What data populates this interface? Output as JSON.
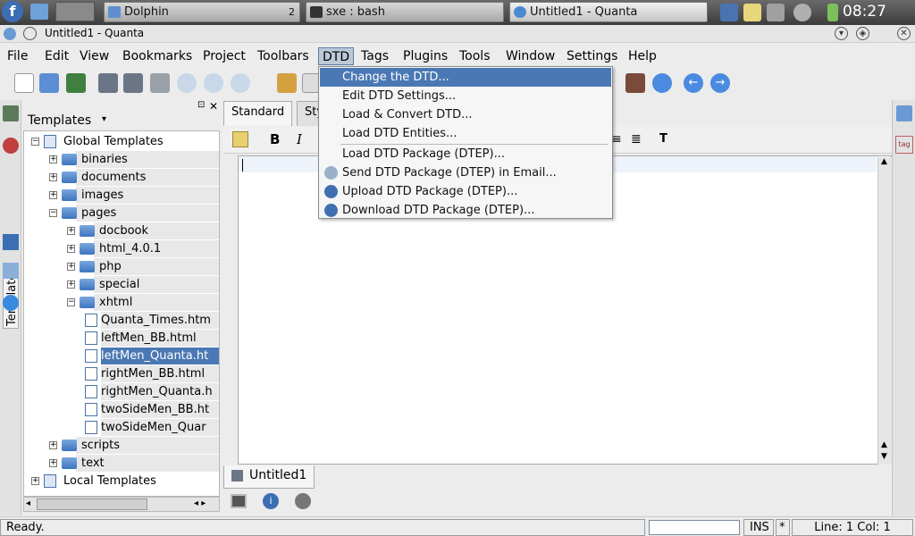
{
  "taskbar": {
    "tasks": [
      {
        "label": "Dolphin",
        "badge": "2"
      },
      {
        "label": "sxe : bash"
      },
      {
        "label": "Untitled1 - Quanta"
      }
    ],
    "clock": "08:27"
  },
  "window": {
    "title": "Untitled1 - Quanta"
  },
  "menubar": [
    "File",
    "Edit",
    "View",
    "Bookmarks",
    "Project",
    "Toolbars",
    "DTD",
    "Tags",
    "Plugins",
    "Tools",
    "Window",
    "Settings",
    "Help"
  ],
  "side_tab": {
    "label": "Templates"
  },
  "templates_panel": {
    "title": "Templates",
    "tree": [
      {
        "label": "Global Templates",
        "type": "root",
        "state": "-"
      },
      {
        "label": "binaries",
        "type": "folder",
        "state": "+"
      },
      {
        "label": "documents",
        "type": "folder",
        "state": "+"
      },
      {
        "label": "images",
        "type": "folder",
        "state": "+"
      },
      {
        "label": "pages",
        "type": "folder",
        "state": "-"
      },
      {
        "label": "docbook",
        "type": "folder",
        "state": "+"
      },
      {
        "label": "html_4.0.1",
        "type": "folder",
        "state": "+"
      },
      {
        "label": "php",
        "type": "folder",
        "state": "+"
      },
      {
        "label": "special",
        "type": "folder",
        "state": "+"
      },
      {
        "label": "xhtml",
        "type": "folder",
        "state": "-"
      },
      {
        "label": "Quanta_Times.htm",
        "type": "file"
      },
      {
        "label": "leftMen_BB.html",
        "type": "file"
      },
      {
        "label": "leftMen_Quanta.ht",
        "type": "file",
        "selected": true
      },
      {
        "label": "rightMen_BB.html",
        "type": "file"
      },
      {
        "label": "rightMen_Quanta.h",
        "type": "file"
      },
      {
        "label": "twoSideMen_BB.ht",
        "type": "file"
      },
      {
        "label": "twoSideMen_Quar",
        "type": "file"
      },
      {
        "label": "scripts",
        "type": "folder",
        "state": "+"
      },
      {
        "label": "text",
        "type": "folder",
        "state": "+"
      },
      {
        "label": "Local Templates",
        "type": "root",
        "state": "+"
      }
    ]
  },
  "editor": {
    "toolbar_tabs": [
      "Standard",
      "Sty"
    ],
    "document_tab": "Untitled1"
  },
  "dtd_menu": {
    "items": [
      {
        "label": "Change the DTD...",
        "highlight": true
      },
      {
        "label": "Edit DTD Settings..."
      },
      {
        "label": "Load & Convert DTD..."
      },
      {
        "label": "Load DTD Entities..."
      },
      {
        "label": "Load DTD Package (DTEP)...",
        "sep_before": true
      },
      {
        "label": "Send DTD Package (DTEP) in Email...",
        "icon": "send"
      },
      {
        "label": "Upload DTD Package (DTEP)...",
        "icon": "globe"
      },
      {
        "label": "Download DTD Package (DTEP)...",
        "icon": "globe"
      }
    ]
  },
  "statusbar": {
    "message": "Ready.",
    "mode": "INS",
    "modified": "*",
    "position": "Line: 1 Col: 1"
  }
}
